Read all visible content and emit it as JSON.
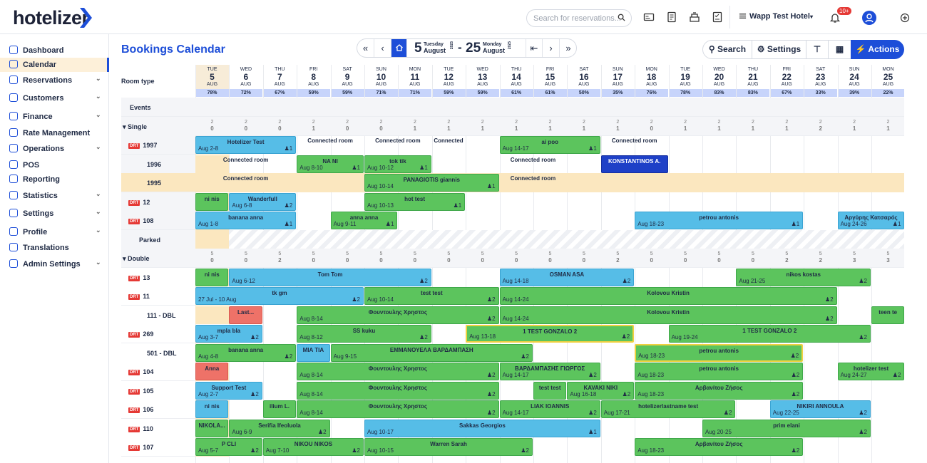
{
  "app": {
    "logo": "hotelizer",
    "search_placeholder": "Search for reservations...",
    "hotel_name": "Wapp Test Hotel",
    "notification_badge": "10+"
  },
  "sidebar": {
    "items": [
      {
        "label": "Dashboard",
        "chev": false
      },
      {
        "label": "Calendar",
        "chev": false,
        "active": true
      },
      {
        "label": "Reservations",
        "chev": true
      },
      {
        "label": "Customers",
        "chev": true
      },
      {
        "label": "Finance",
        "chev": true
      },
      {
        "label": "Rate Management",
        "chev": false
      },
      {
        "label": "Operations",
        "chev": true
      },
      {
        "label": "POS",
        "chev": false
      },
      {
        "label": "Reporting",
        "chev": false
      },
      {
        "label": "Statistics",
        "chev": true
      },
      {
        "label": "Settings",
        "chev": true
      },
      {
        "label": "Profile",
        "chev": true
      },
      {
        "label": "Translations",
        "chev": false
      },
      {
        "label": "Admin Settings",
        "chev": true
      }
    ]
  },
  "page": {
    "title": "Bookings Calendar"
  },
  "range": {
    "start_day": "5",
    "start_weekday": "Tuesday",
    "start_month": "August",
    "start_year": "2025",
    "sep": "-",
    "end_day": "25",
    "end_weekday": "Monday",
    "end_month": "August",
    "end_year": "2025"
  },
  "toolbar": {
    "search": "Search",
    "settings": "Settings",
    "actions": "Actions"
  },
  "grid": {
    "room_type_label": "Room type",
    "events_label": "Events",
    "parked_label": "Parked",
    "dirty_label": "DRT"
  },
  "days": [
    {
      "dow": "TUE",
      "n": "5",
      "m": "AUG",
      "occ": "78%"
    },
    {
      "dow": "WED",
      "n": "6",
      "m": "AUG",
      "occ": "72%"
    },
    {
      "dow": "THU",
      "n": "7",
      "m": "AUG",
      "occ": "67%"
    },
    {
      "dow": "FRI",
      "n": "8",
      "m": "AUG",
      "occ": "59%"
    },
    {
      "dow": "SAT",
      "n": "9",
      "m": "AUG",
      "occ": "59%"
    },
    {
      "dow": "SUN",
      "n": "10",
      "m": "AUG",
      "occ": "71%"
    },
    {
      "dow": "MON",
      "n": "11",
      "m": "AUG",
      "occ": "71%"
    },
    {
      "dow": "TUE",
      "n": "12",
      "m": "AUG",
      "occ": "59%"
    },
    {
      "dow": "WED",
      "n": "13",
      "m": "AUG",
      "occ": "59%"
    },
    {
      "dow": "THU",
      "n": "14",
      "m": "AUG",
      "occ": "61%"
    },
    {
      "dow": "FRI",
      "n": "15",
      "m": "AUG",
      "occ": "61%"
    },
    {
      "dow": "SAT",
      "n": "16",
      "m": "AUG",
      "occ": "50%"
    },
    {
      "dow": "SUN",
      "n": "17",
      "m": "AUG",
      "occ": "35%"
    },
    {
      "dow": "MON",
      "n": "18",
      "m": "AUG",
      "occ": "76%"
    },
    {
      "dow": "TUE",
      "n": "19",
      "m": "AUG",
      "occ": "78%"
    },
    {
      "dow": "WED",
      "n": "20",
      "m": "AUG",
      "occ": "83%"
    },
    {
      "dow": "THU",
      "n": "21",
      "m": "AUG",
      "occ": "83%"
    },
    {
      "dow": "FRI",
      "n": "22",
      "m": "AUG",
      "occ": "67%"
    },
    {
      "dow": "SAT",
      "n": "23",
      "m": "AUG",
      "occ": "33%"
    },
    {
      "dow": "SUN",
      "n": "24",
      "m": "AUG",
      "occ": "39%"
    },
    {
      "dow": "MON",
      "n": "25",
      "m": "AUG",
      "occ": "22%"
    }
  ],
  "groups": [
    {
      "label": "Single",
      "top": [
        2,
        2,
        2,
        2,
        2,
        2,
        2,
        2,
        2,
        2,
        2,
        2,
        2,
        2,
        2,
        2,
        2,
        2,
        2,
        2,
        2
      ],
      "bottom": [
        0,
        0,
        0,
        1,
        0,
        0,
        1,
        1,
        1,
        1,
        1,
        1,
        1,
        0,
        1,
        1,
        1,
        1,
        2,
        1,
        1
      ]
    },
    {
      "label": "Double",
      "top": [
        5,
        5,
        5,
        5,
        5,
        5,
        5,
        5,
        5,
        5,
        5,
        5,
        5,
        5,
        5,
        5,
        5,
        5,
        5,
        5,
        5
      ],
      "bottom": [
        0,
        0,
        2,
        0,
        0,
        0,
        0,
        0,
        0,
        0,
        0,
        0,
        2,
        0,
        0,
        0,
        0,
        2,
        2,
        3,
        3
      ]
    }
  ],
  "rooms": [
    {
      "label": "1997",
      "dirty": true
    },
    {
      "label": "1996",
      "dirty": false
    },
    {
      "label": "1995",
      "dirty": false
    },
    {
      "label": "12",
      "dirty": true
    },
    {
      "label": "108",
      "dirty": true
    },
    {
      "label": "13",
      "dirty": true
    },
    {
      "label": "11",
      "dirty": true
    },
    {
      "label": "111 - DBL",
      "dirty": false
    },
    {
      "label": "269",
      "dirty": true
    },
    {
      "label": "501 - DBL",
      "dirty": false
    },
    {
      "label": "104",
      "dirty": true
    },
    {
      "label": "105",
      "dirty": true
    },
    {
      "label": "106",
      "dirty": true
    },
    {
      "label": "110",
      "dirty": true
    },
    {
      "label": "107",
      "dirty": true
    }
  ],
  "bookings": [
    {
      "row": 0,
      "c": 0,
      "s": 3,
      "col": "b",
      "nm": "Hotelizer Test",
      "dt": "Aug 2-8",
      "gs": "1"
    },
    {
      "row": 0,
      "c": 3,
      "s": 2,
      "col": "conn",
      "nm": "Connected room"
    },
    {
      "row": 0,
      "c": 5,
      "s": 2,
      "col": "conn",
      "nm": "Connected room"
    },
    {
      "row": 0,
      "c": 7,
      "s": 1,
      "col": "conn",
      "nm": "Connected"
    },
    {
      "row": 0,
      "c": 9,
      "s": 3,
      "col": "g",
      "nm": "ai poo",
      "dt": "Aug 14-17",
      "gs": "1"
    },
    {
      "row": 0,
      "c": 12,
      "s": 2,
      "col": "conn",
      "nm": "Connected room"
    },
    {
      "row": 1,
      "c": 0,
      "s": 3,
      "col": "conn",
      "nm": "Connected room"
    },
    {
      "row": 1,
      "c": 3,
      "s": 2,
      "col": "g",
      "nm": "NA NI",
      "dt": "Aug 8-10",
      "gs": "1"
    },
    {
      "row": 1,
      "c": 5,
      "s": 2,
      "col": "g",
      "nm": "tok tik",
      "dt": "Aug 10-12",
      "gs": "1"
    },
    {
      "row": 1,
      "c": 9,
      "s": 2,
      "col": "conn",
      "nm": "Connected room"
    },
    {
      "row": 1,
      "c": 12,
      "s": 2,
      "col": "nv",
      "nm": "KONSTANTINOS A."
    },
    {
      "row": 2,
      "c": 0,
      "s": 3,
      "col": "conn",
      "nm": "Connected room"
    },
    {
      "row": 2,
      "c": 5,
      "s": 4,
      "col": "g",
      "nm": "PANAGIOTIS giannis",
      "dt": "Aug 10-14",
      "gs": "1"
    },
    {
      "row": 2,
      "c": 9,
      "s": 2,
      "col": "conn",
      "nm": "Connected room"
    },
    {
      "row": 3,
      "c": 0,
      "s": 1,
      "col": "g",
      "nm": "ni nis"
    },
    {
      "row": 3,
      "c": 1,
      "s": 2,
      "col": "b",
      "nm": "Wanderfull",
      "dt": "Aug 6-8",
      "gs": "2"
    },
    {
      "row": 3,
      "c": 5,
      "s": 3,
      "col": "g",
      "nm": "hot test",
      "dt": "Aug 10-13",
      "gs": "1"
    },
    {
      "row": 4,
      "c": 0,
      "s": 3,
      "col": "b",
      "nm": "banana anna",
      "dt": "Aug 1-8",
      "gs": "1"
    },
    {
      "row": 4,
      "c": 4,
      "s": 2,
      "col": "g",
      "nm": "anna anna",
      "dt": "Aug 9-11",
      "gs": "1"
    },
    {
      "row": 4,
      "c": 13,
      "s": 5,
      "col": "b",
      "nm": "petrou antonis",
      "dt": "Aug 18-23",
      "gs": "1"
    },
    {
      "row": 4,
      "c": 19,
      "s": 2,
      "col": "b",
      "nm": "Αργύρης Κατσαρός",
      "dt": "Aug 24-26",
      "gs": "1"
    },
    {
      "row": 5,
      "c": 0,
      "s": 1,
      "col": "g",
      "nm": "ni nis"
    },
    {
      "row": 5,
      "c": 1,
      "s": 6,
      "col": "b",
      "nm": "Tom Tom",
      "dt": "Aug 6-12",
      "gs": "2"
    },
    {
      "row": 5,
      "c": 9,
      "s": 4,
      "col": "b",
      "nm": "OSMAN ASA",
      "dt": "Aug 14-18",
      "gs": "2"
    },
    {
      "row": 5,
      "c": 16,
      "s": 4,
      "col": "g",
      "nm": "nikos kostas",
      "dt": "Aug 21-25",
      "gs": "2"
    },
    {
      "row": 6,
      "c": 0,
      "s": 5,
      "col": "b",
      "nm": "tk gm",
      "dt": "27 Jul - 10 Aug",
      "gs": "2"
    },
    {
      "row": 6,
      "c": 5,
      "s": 4,
      "col": "g",
      "nm": "test test",
      "dt": "Aug 10-14",
      "gs": "2"
    },
    {
      "row": 6,
      "c": 9,
      "s": 10,
      "col": "g",
      "nm": "Kolovou Kristin",
      "dt": "Aug 14-24",
      "gs": "2"
    },
    {
      "row": 7,
      "c": 1,
      "s": 1,
      "col": "r",
      "nm": "Last..."
    },
    {
      "row": 7,
      "c": 3,
      "s": 6,
      "col": "g",
      "nm": "Φουντουλης Χρηστος",
      "dt": "Aug 8-14",
      "gs": "2"
    },
    {
      "row": 7,
      "c": 9,
      "s": 10,
      "col": "g",
      "nm": "Kolovou Kristin",
      "dt": "Aug 14-24",
      "gs": "2"
    },
    {
      "row": 7,
      "c": 20,
      "s": 1,
      "col": "g",
      "nm": "teen te"
    },
    {
      "row": 8,
      "c": 0,
      "s": 2,
      "col": "b",
      "nm": "mpla bla",
      "dt": "Aug 3-7",
      "gs": "2"
    },
    {
      "row": 8,
      "c": 3,
      "s": 4,
      "col": "g",
      "nm": "SS kuku",
      "dt": "Aug 8-12",
      "gs": "2"
    },
    {
      "row": 8,
      "c": 8,
      "s": 5,
      "col": "g y",
      "nm": "1 TEST GONZALO 2",
      "dt": "Aug 13-18",
      "gs": "2"
    },
    {
      "row": 8,
      "c": 14,
      "s": 6,
      "col": "g",
      "nm": "1 TEST GONZALO 2",
      "dt": "Aug 19-24",
      "gs": "2"
    },
    {
      "row": 9,
      "c": 0,
      "s": 3,
      "col": "g",
      "nm": "banana anna",
      "dt": "Aug 4-8",
      "gs": "2"
    },
    {
      "row": 9,
      "c": 3,
      "s": 1,
      "col": "b",
      "nm": "MIA TIA"
    },
    {
      "row": 9,
      "c": 4,
      "s": 6,
      "col": "g",
      "nm": "ΕΜΜΑΝΟΥΕΛΑ ΒΑΡΔΑΜΠΑΣΗ",
      "dt": "Aug 9-15",
      "gs": "2"
    },
    {
      "row": 9,
      "c": 13,
      "s": 5,
      "col": "g y",
      "nm": "petrou antonis",
      "dt": "Aug 18-23",
      "gs": "2"
    },
    {
      "row": 10,
      "c": 0,
      "s": 1,
      "col": "r",
      "nm": "Anna"
    },
    {
      "row": 10,
      "c": 3,
      "s": 6,
      "col": "g",
      "nm": "Φουντουλης Χρηστος",
      "dt": "Aug 8-14",
      "gs": "2"
    },
    {
      "row": 10,
      "c": 9,
      "s": 3,
      "col": "g",
      "nm": "ΒΑΡΔΑΜΠΑΣΗΣ ΓΙΩΡΓΟΣ",
      "dt": "Aug 14-17",
      "gs": "2"
    },
    {
      "row": 10,
      "c": 13,
      "s": 5,
      "col": "g",
      "nm": "petrou antonis",
      "dt": "Aug 18-23",
      "gs": "2"
    },
    {
      "row": 10,
      "c": 19,
      "s": 2,
      "col": "g",
      "nm": "hotelizer test",
      "dt": "Aug 24-27",
      "gs": "2"
    },
    {
      "row": 11,
      "c": 0,
      "s": 2,
      "col": "b",
      "nm": "Support Test",
      "dt": "Aug 2-7",
      "gs": "2"
    },
    {
      "row": 11,
      "c": 3,
      "s": 6,
      "col": "g",
      "nm": "Φουντουλης Χρηστος",
      "dt": "Aug 8-14",
      "gs": "2"
    },
    {
      "row": 11,
      "c": 10,
      "s": 1,
      "col": "g",
      "nm": "test test"
    },
    {
      "row": 11,
      "c": 11,
      "s": 2,
      "col": "g",
      "nm": "KAVAKI NIKI",
      "dt": "Aug 16-18",
      "gs": "2"
    },
    {
      "row": 11,
      "c": 13,
      "s": 5,
      "col": "g",
      "nm": "Αρβανίτου Ζήσος",
      "dt": "Aug 18-23",
      "gs": "2"
    },
    {
      "row": 12,
      "c": 0,
      "s": 1,
      "col": "b",
      "nm": "ni nis"
    },
    {
      "row": 12,
      "c": 2,
      "s": 1,
      "col": "g",
      "nm": "ilium L."
    },
    {
      "row": 12,
      "c": 3,
      "s": 6,
      "col": "g",
      "nm": "Φουντουλης Χρηστος",
      "dt": "Aug 8-14",
      "gs": "2"
    },
    {
      "row": 12,
      "c": 9,
      "s": 3,
      "col": "g",
      "nm": "LIAK IOANNIS",
      "dt": "Aug 14-17",
      "gs": "2"
    },
    {
      "row": 12,
      "c": 12,
      "s": 4,
      "col": "g",
      "nm": "hotelizerlastname test",
      "dt": "Aug 17-21",
      "gs": "2"
    },
    {
      "row": 12,
      "c": 17,
      "s": 3,
      "col": "b",
      "nm": "NIKIRI ANNOULA",
      "dt": "Aug 22-25",
      "gs": "2"
    },
    {
      "row": 13,
      "c": 0,
      "s": 1,
      "col": "g",
      "nm": "NIKOLA..."
    },
    {
      "row": 13,
      "c": 1,
      "s": 3,
      "col": "g",
      "nm": "Serifia Ifeoluola",
      "dt": "Aug 6-9",
      "gs": "2"
    },
    {
      "row": 13,
      "c": 5,
      "s": 7,
      "col": "b",
      "nm": "Sakkas Georgios",
      "dt": "Aug 10-17",
      "gs": "1"
    },
    {
      "row": 13,
      "c": 15,
      "s": 5,
      "col": "g",
      "nm": "prim elani",
      "dt": "Aug 20-25",
      "gs": "2"
    },
    {
      "row": 14,
      "c": 0,
      "s": 2,
      "col": "g",
      "nm": "P CLI",
      "dt": "Aug 5-7",
      "gs": "2"
    },
    {
      "row": 14,
      "c": 2,
      "s": 3,
      "col": "g",
      "nm": "NIKOU NIKOS",
      "dt": "Aug 7-10",
      "gs": "2"
    },
    {
      "row": 14,
      "c": 5,
      "s": 5,
      "col": "g",
      "nm": "Warren Sarah",
      "dt": "Aug 10-15",
      "gs": "2"
    },
    {
      "row": 14,
      "c": 13,
      "s": 5,
      "col": "g",
      "nm": "Αρβανίτου Ζήσος",
      "dt": "Aug 18-23",
      "gs": "2"
    }
  ]
}
